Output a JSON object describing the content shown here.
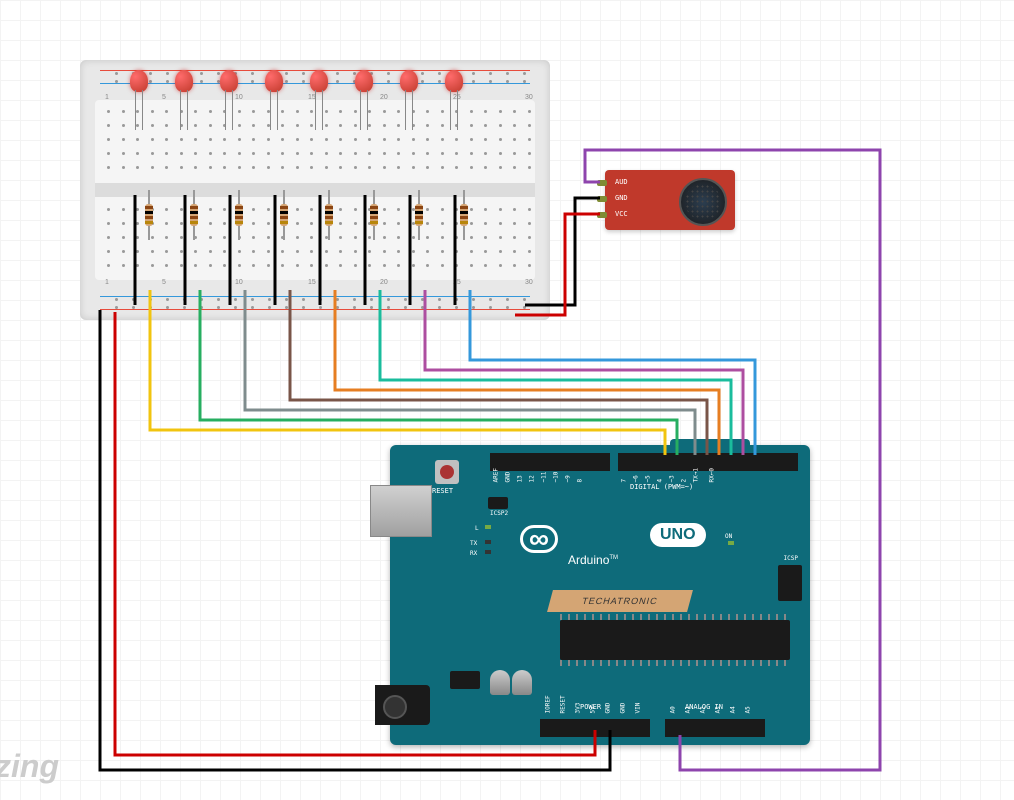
{
  "watermark": "zing",
  "breadboard": {
    "column_markers_top": [
      "1",
      "5",
      "10",
      "15",
      "20",
      "25",
      "30"
    ],
    "column_markers_bot": [
      "1",
      "5",
      "10",
      "15",
      "20",
      "25",
      "30"
    ]
  },
  "leds": {
    "count": 8,
    "color": "#c0392b"
  },
  "resistors": {
    "count": 8,
    "bands": [
      "#8b4513",
      "#000000",
      "#8b4513",
      "#b8860b"
    ]
  },
  "sound_module": {
    "pins": [
      "AUD",
      "GND",
      "VCC"
    ]
  },
  "arduino": {
    "brand": "Arduino",
    "model": "UNO",
    "tm": "TM",
    "reset_label": "RESET",
    "icsp2_label": "ICSP2",
    "icsp_label": "ICSP",
    "on_label": "ON",
    "l_label": "L",
    "tx_label": "TX",
    "rx_label": "RX",
    "digital_group": "DIGITAL (PWM=~)",
    "power_group": "POWER",
    "analog_group": "ANALOG IN",
    "digital_pins": [
      "AREF",
      "GND",
      "13",
      "12",
      "~11",
      "~10",
      "~9",
      "8",
      "7",
      "~6",
      "~5",
      "4",
      "~3",
      "2",
      "TX→1",
      "RX←0"
    ],
    "power_pins": [
      "IOREF",
      "RESET",
      "3V3",
      "5V",
      "GND",
      "GND",
      "VIN"
    ],
    "analog_pins": [
      "A0",
      "A1",
      "A2",
      "A3",
      "A4",
      "A5"
    ],
    "techatronic": "TECHATRONIC"
  },
  "wires": [
    {
      "name": "gnd-black",
      "color": "#000000",
      "from": "breadboard-gnd-rail",
      "to": "arduino-gnd"
    },
    {
      "name": "vcc-red",
      "color": "#cc0000",
      "from": "breadboard-vcc-rail",
      "to": "arduino-5v"
    },
    {
      "name": "led1-yellow",
      "color": "#f1c40f",
      "from": "led1",
      "to": "arduino-d9"
    },
    {
      "name": "led2-green",
      "color": "#27ae60",
      "from": "led2",
      "to": "arduino-d8"
    },
    {
      "name": "led3-gray",
      "color": "#7f8c8d",
      "from": "led3",
      "to": "arduino-d7"
    },
    {
      "name": "led4-brown",
      "color": "#795548",
      "from": "led4",
      "to": "arduino-d6"
    },
    {
      "name": "led5-orange",
      "color": "#e67e22",
      "from": "led5",
      "to": "arduino-d5"
    },
    {
      "name": "led6-cyan",
      "color": "#1abc9c",
      "from": "led6",
      "to": "arduino-d4"
    },
    {
      "name": "led7-magenta",
      "color": "#ad4ea0",
      "from": "led7",
      "to": "arduino-d3"
    },
    {
      "name": "led8-blue",
      "color": "#3498db",
      "from": "led8",
      "to": "arduino-d2"
    },
    {
      "name": "mic-aud-purple",
      "color": "#8e44ad",
      "from": "sound-aud",
      "to": "arduino-a0"
    },
    {
      "name": "mic-gnd-black",
      "color": "#000000",
      "from": "sound-gnd",
      "to": "breadboard-gnd"
    },
    {
      "name": "mic-vcc-red",
      "color": "#cc0000",
      "from": "sound-vcc",
      "to": "breadboard-vcc"
    }
  ]
}
